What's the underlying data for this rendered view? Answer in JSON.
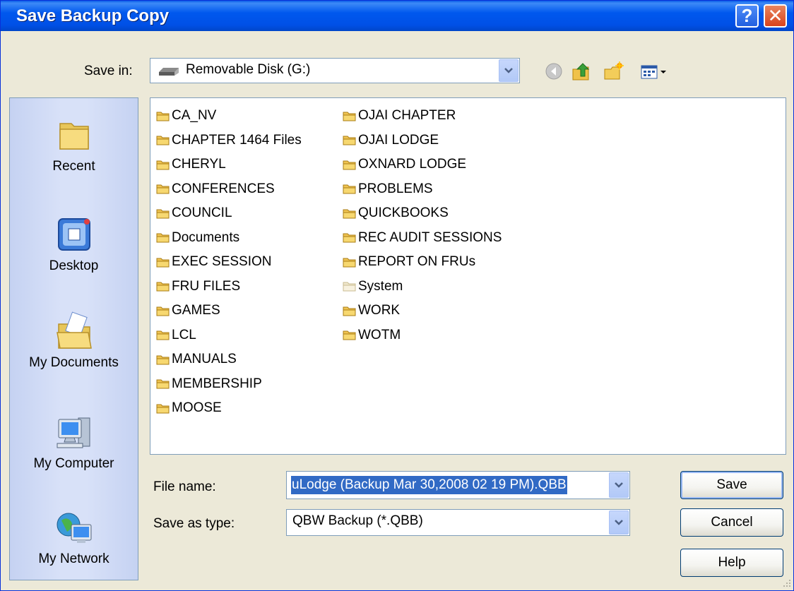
{
  "dialog": {
    "title": "Save Backup Copy"
  },
  "title_buttons": {
    "help": "?",
    "close": "✕"
  },
  "save_in": {
    "label": "Save in:",
    "value": "Removable Disk (G:)"
  },
  "toolbar": [
    "back-icon",
    "up-folder-icon",
    "new-folder-icon",
    "views-menu-icon"
  ],
  "places": [
    {
      "label": "Recent",
      "icon": "recent-folder-icon"
    },
    {
      "label": "Desktop",
      "icon": "desktop-icon"
    },
    {
      "label": "My Documents",
      "icon": "my-documents-icon"
    },
    {
      "label": "My Computer",
      "icon": "my-computer-icon"
    },
    {
      "label": "My Network",
      "icon": "my-network-icon"
    }
  ],
  "files": {
    "column1": [
      "CA_NV",
      "CHAPTER 1464 Files",
      "CHERYL",
      "CONFERENCES",
      "COUNCIL",
      "Documents",
      "EXEC SESSION",
      "FRU FILES",
      "GAMES",
      "LCL",
      "MANUALS",
      "MEMBERSHIP",
      "MOOSE"
    ],
    "column2": [
      "OJAI CHAPTER",
      "OJAI LODGE",
      "OXNARD LODGE",
      "PROBLEMS",
      "QUICKBOOKS",
      "REC AUDIT SESSIONS",
      "REPORT ON FRUs",
      "System",
      "WORK",
      "WOTM"
    ]
  },
  "filename": {
    "label": "File name:",
    "value": "uLodge (Backup Mar 30,2008  02 19 PM).QBB"
  },
  "filetype": {
    "label": "Save as type:",
    "value": "QBW Backup (*.QBB)"
  },
  "buttons": {
    "save": "Save",
    "cancel": "Cancel",
    "help": "Help"
  },
  "colors": {
    "titlebar": "#0058ee",
    "selection": "#316ac5",
    "dialog_bg": "#ece9d8"
  }
}
